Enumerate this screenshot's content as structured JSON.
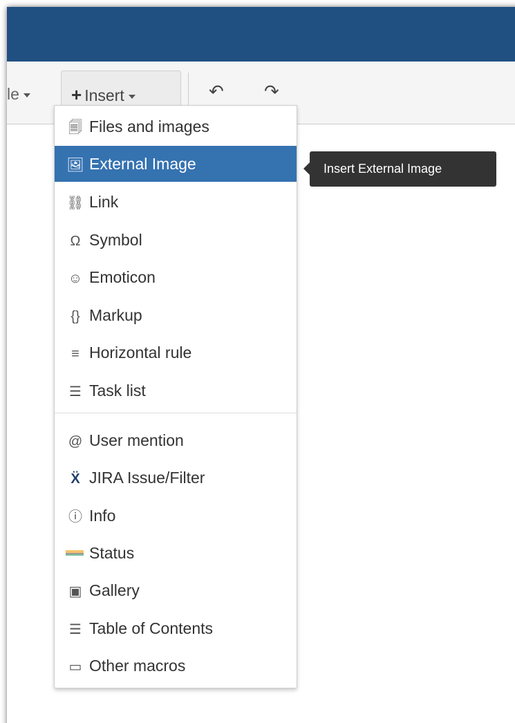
{
  "toolbar": {
    "style_label": "le",
    "insert_label": "Insert",
    "undo_icon": "undo-icon",
    "redo_icon": "redo-icon"
  },
  "menu": {
    "items": [
      {
        "label": "Files and images",
        "icon": "files-images-icon",
        "glyph": "🗐"
      },
      {
        "label": "External Image",
        "icon": "external-image-icon",
        "glyph": "🖼",
        "active": true
      },
      {
        "label": "Link",
        "icon": "link-icon",
        "glyph": "⛓"
      },
      {
        "label": "Symbol",
        "icon": "omega-icon",
        "glyph": "Ω"
      },
      {
        "label": "Emoticon",
        "icon": "smiley-icon",
        "glyph": "☺"
      },
      {
        "label": "Markup",
        "icon": "braces-icon",
        "glyph": "{}"
      },
      {
        "label": "Horizontal rule",
        "icon": "horizontal-rule-icon",
        "glyph": "≡"
      },
      {
        "label": "Task list",
        "icon": "task-list-icon",
        "glyph": "☰"
      },
      {
        "label": "User mention",
        "icon": "at-icon",
        "glyph": "@"
      },
      {
        "label": "JIRA Issue/Filter",
        "icon": "jira-icon",
        "glyph": "Ẍ"
      },
      {
        "label": "Info",
        "icon": "info-icon",
        "glyph": "ⓘ"
      },
      {
        "label": "Status",
        "icon": "status-icon",
        "glyph": ""
      },
      {
        "label": "Gallery",
        "icon": "gallery-icon",
        "glyph": "▣"
      },
      {
        "label": "Table of Contents",
        "icon": "toc-icon",
        "glyph": "☰"
      },
      {
        "label": "Other macros",
        "icon": "macros-icon",
        "glyph": "▭"
      }
    ]
  },
  "tooltip": {
    "text": "Insert External Image"
  },
  "colors": {
    "header": "#205081",
    "active_item": "#3572b0",
    "tooltip_bg": "#333333"
  }
}
